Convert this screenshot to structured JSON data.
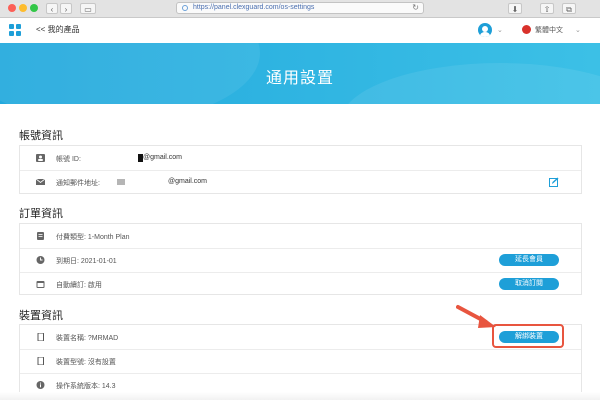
{
  "browser": {
    "url": "https://panel.clexguard.com/os-settings"
  },
  "header": {
    "back_label": "<< 我的產品",
    "language": "繁體中文"
  },
  "banner": {
    "title": "通用設置"
  },
  "account": {
    "section_title": "帳號資訊",
    "id_label": "帳號 ID:",
    "id_value": "@gmail.com",
    "email_label": "通知郵件地址:",
    "email_value": "@gmail.com"
  },
  "order": {
    "section_title": "訂單資訊",
    "plan": "付費類型: 1-Month Plan",
    "expiry": "到期日: 2021-01-01",
    "autorenew": "自動續訂: 啟用",
    "extend_button": "延長會員",
    "cancel_button": "取消訂閱"
  },
  "device": {
    "section_title": "裝置資訊",
    "name": "裝置名稱: ?MRMAD",
    "model": "裝置型號: 沒有設置",
    "os": "操作系統版本: 14.3",
    "unbind_button": "解綁裝置"
  },
  "colors": {
    "accent": "#1e9fd8",
    "highlight": "#e8553f"
  }
}
